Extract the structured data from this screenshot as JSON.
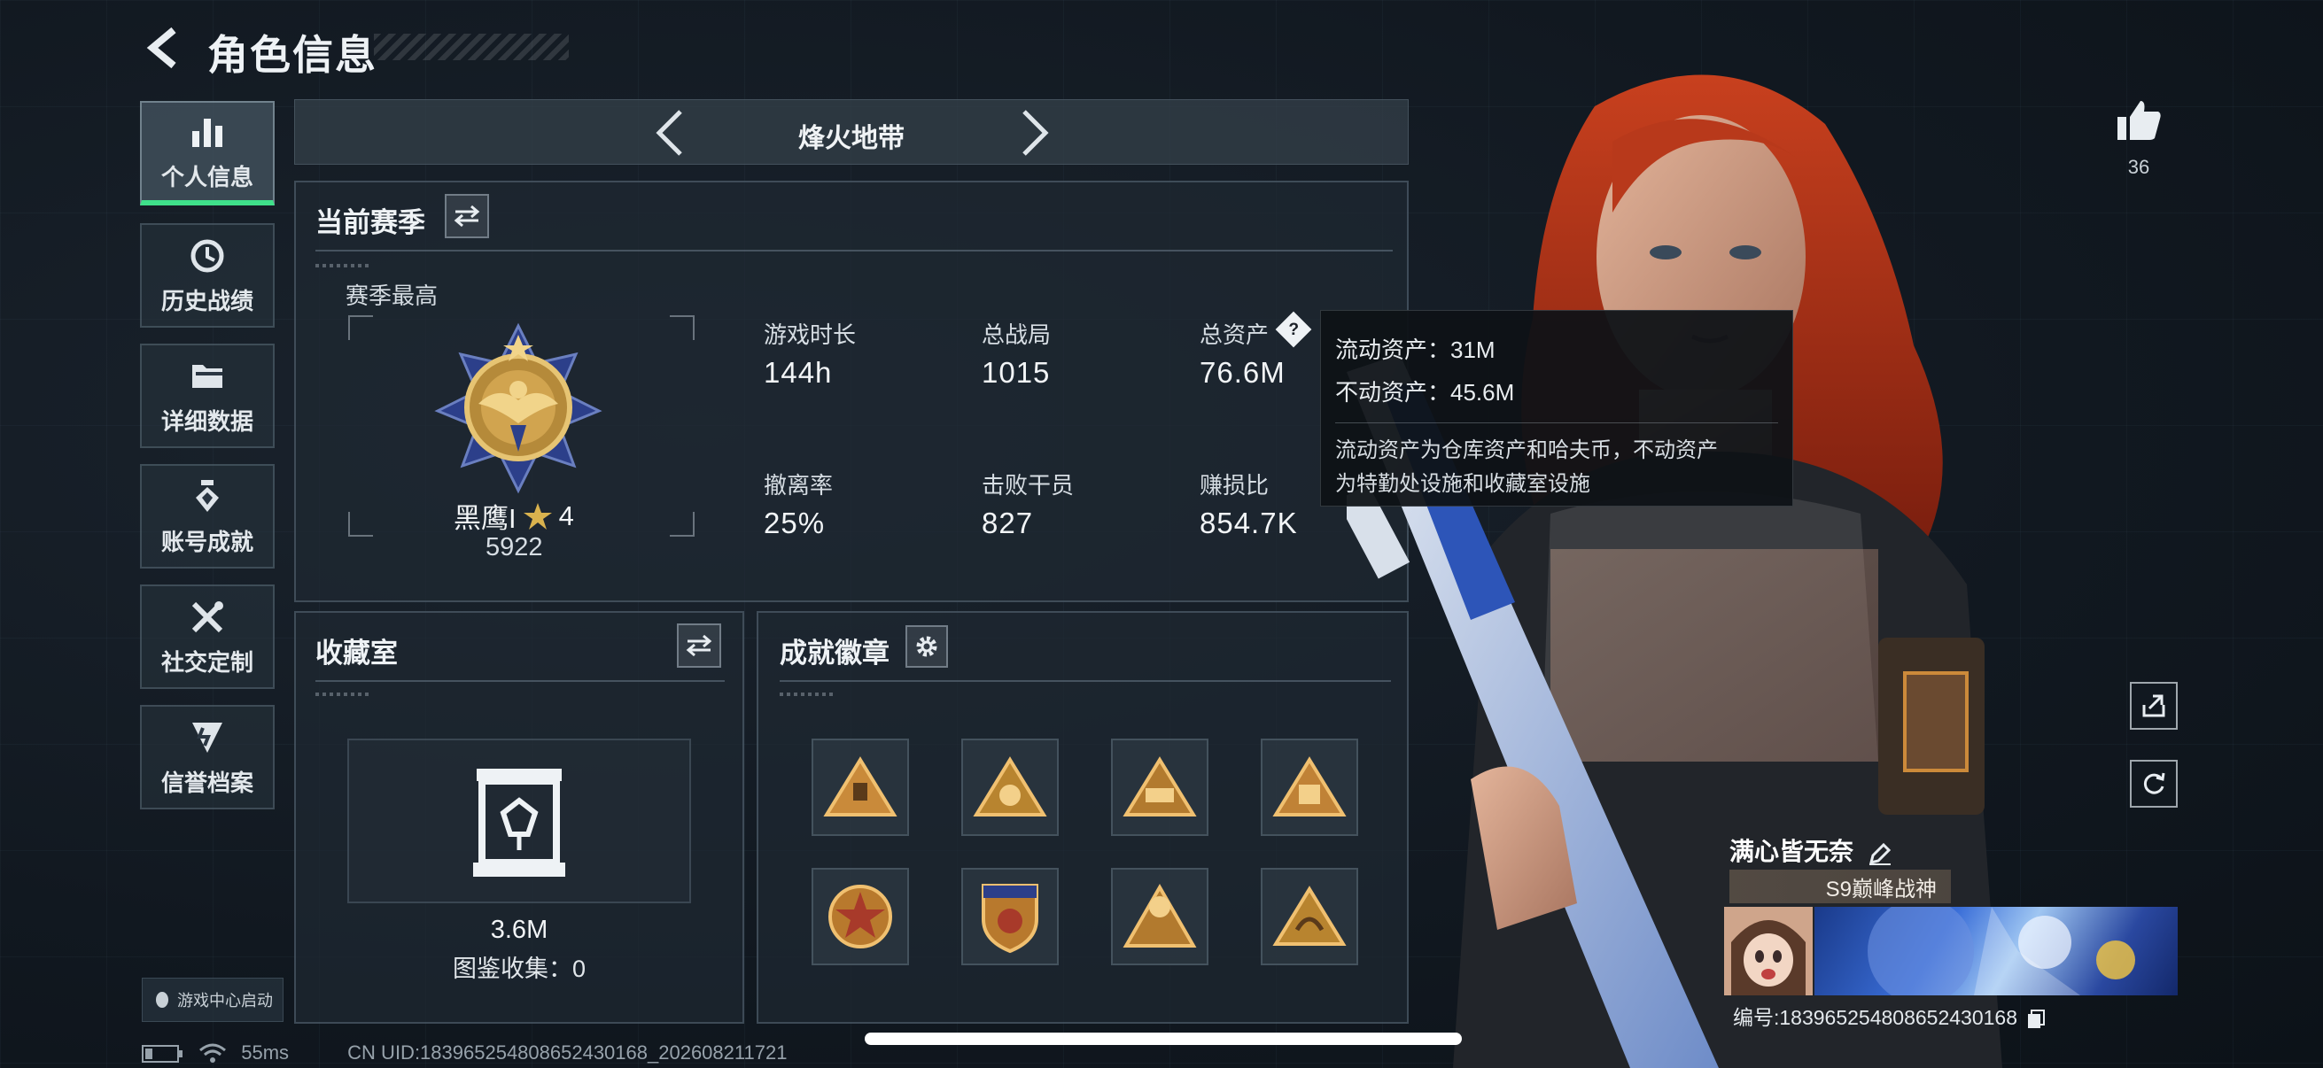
{
  "header": {
    "title": "角色信息"
  },
  "sidebar": {
    "items": [
      {
        "label": "个人信息",
        "icon": "bar-chart-icon",
        "active": true
      },
      {
        "label": "历史战绩",
        "icon": "history-clock-icon"
      },
      {
        "label": "详细数据",
        "icon": "folder-icon"
      },
      {
        "label": "账号成就",
        "icon": "achievement-icon"
      },
      {
        "label": "社交定制",
        "icon": "tools-icon"
      },
      {
        "label": "信誉档案",
        "icon": "reputation-icon"
      }
    ],
    "game_center": "游戏中心启动"
  },
  "mode": {
    "title": "烽火地带"
  },
  "season": {
    "title": "当前赛季",
    "best_label": "赛季最高",
    "rank_name": "黑鹰I",
    "rank_stars": "4",
    "rank_score": "5922",
    "stats": [
      {
        "label": "游戏时长",
        "value": "144h"
      },
      {
        "label": "总战局",
        "value": "1015"
      },
      {
        "label": "总资产",
        "value": "76.6M"
      },
      {
        "label": "撤离率",
        "value": "25%"
      },
      {
        "label": "击败干员",
        "value": "827"
      },
      {
        "label": "赚损比",
        "value": "854.7K"
      }
    ]
  },
  "tooltip": {
    "liquid": "流动资产：31M",
    "fixed": "不动资产：45.6M",
    "desc_line1": "流动资产为仓库资产和哈夫币，不动资产",
    "desc_line2": "为特勤处设施和收藏室设施"
  },
  "collection": {
    "title": "收藏室",
    "value": "3.6M",
    "catalog": "图鉴收集：0"
  },
  "badges": {
    "title": "成就徽章"
  },
  "profile": {
    "likes": "36",
    "name": "满心皆无奈",
    "title_tag": "S9巅峰战神",
    "id_text": "编号:1839652548086524301​68"
  },
  "status": {
    "ping": "55ms",
    "uid": "CN UID:18396525480865243​0168_202608211721"
  },
  "colors": {
    "accent_green": "#3fe08a",
    "gold": "#c9a24a",
    "navy": "#2c3f8a"
  }
}
